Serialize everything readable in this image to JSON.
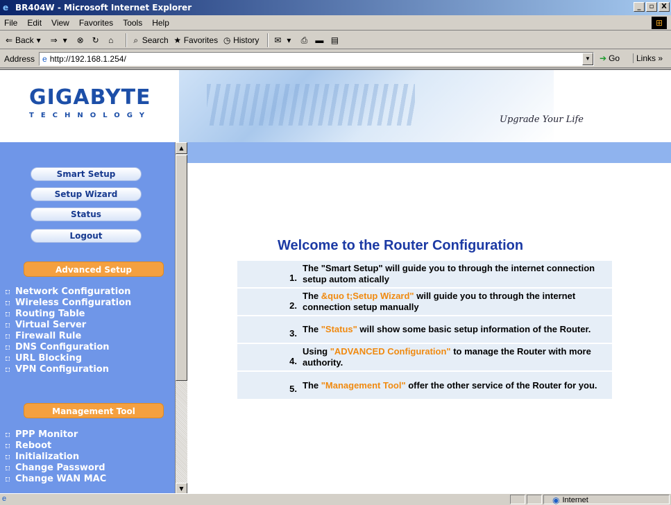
{
  "window": {
    "title": "BR404W - Microsoft Internet Explorer",
    "controls": [
      "_",
      "▫",
      "X"
    ]
  },
  "menubar": [
    "File",
    "Edit",
    "View",
    "Favorites",
    "Tools",
    "Help"
  ],
  "toolbar": {
    "back": "Back",
    "search": "Search",
    "favorites": "Favorites",
    "history": "History"
  },
  "address": {
    "label": "Address",
    "url": "http://192.168.1.254/",
    "go": "Go",
    "links": "Links"
  },
  "banner": {
    "logo": "GIGABYTE",
    "logo_sub": "TECHNOLOGY",
    "tagline": "Upgrade Your Life"
  },
  "sidebar": {
    "buttons": [
      "Smart Setup",
      "Setup Wizard",
      "Status",
      "Logout"
    ],
    "advanced_header": "Advanced Setup",
    "advanced_items": [
      "Network Configuration",
      "Wireless Configuration",
      "Routing Table",
      "Virtual Server",
      "Firewall Rule",
      "DNS Configuration",
      "URL Blocking",
      "VPN Configuration"
    ],
    "management_header": "Management Tool",
    "management_items": [
      "PPP Monitor",
      "Reboot",
      "Initialization",
      "Change Password",
      "Change WAN MAC"
    ]
  },
  "main": {
    "welcome": "Welcome to the Router Configuration",
    "items": [
      {
        "num": "1.",
        "pre": "The \"Smart Setup\" will guide you to through the internet connection setup autom atically",
        "hl": "",
        "post": ""
      },
      {
        "num": "2.",
        "pre": "The ",
        "hl": "&quo t;Setup Wizard\"",
        "post": " will guide you to through the internet connection setup manually"
      },
      {
        "num": "3.",
        "pre": "The ",
        "hl": "\"Status\"",
        "post": " will show some basic setup information of the Router."
      },
      {
        "num": "4.",
        "pre": "Using ",
        "hl": "\"ADVANCED Configuration\"",
        "post": " to manage the Router with more authority."
      },
      {
        "num": "5.",
        "pre": "The ",
        "hl": "\"Management Tool\"",
        "post": " offer the other service of the Router for you."
      }
    ]
  },
  "statusbar": {
    "zone": "Internet"
  }
}
